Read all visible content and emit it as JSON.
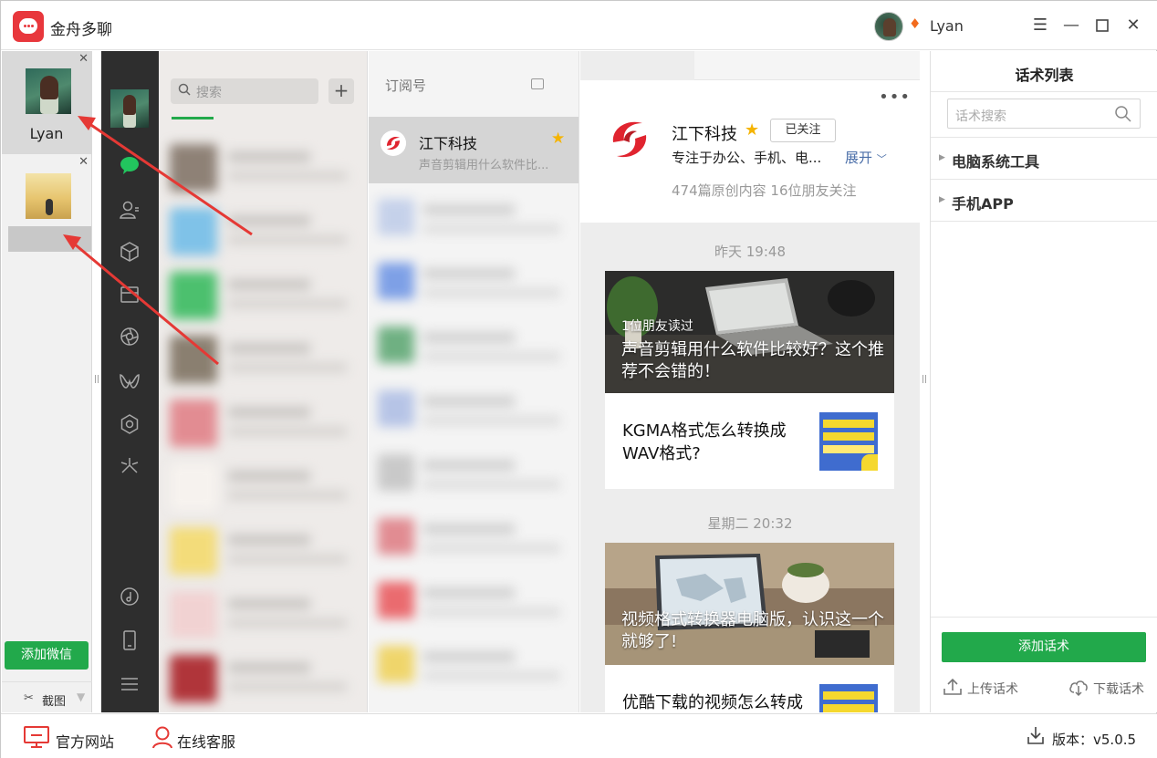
{
  "app": {
    "title": "金舟多聊",
    "user_name": "Lyan"
  },
  "accounts": {
    "items": [
      {
        "name": "Lyan"
      },
      {
        "name": ""
      }
    ],
    "add_label": "添加微信",
    "screenshot_label": "截图"
  },
  "chat_list": {
    "search_placeholder": "搜索",
    "add_label": "+"
  },
  "subscriptions": {
    "title": "订阅号",
    "items": [
      {
        "name": "江下科技",
        "desc": "声音剪辑用什么软件比...",
        "starred": true
      }
    ]
  },
  "article": {
    "account_name": "江下科技",
    "follow_label": "已关注",
    "desc": "专注于办公、手机、电...",
    "expand_label": "展开",
    "stats": "474篇原创内容  16位朋友关注",
    "groups": [
      {
        "time": "昨天  19:48",
        "cover_badge": "1位朋友读过",
        "cover_title": "声音剪辑用什么软件比较好？这个推荐不会错的！",
        "sub_title": "KGMA格式怎么转换成WAV格式?"
      },
      {
        "time": "星期二  20:32",
        "cover_title": "视频格式转换器电脑版，认识这一个就够了!",
        "sub_title": "优酷下载的视频怎么转成"
      }
    ]
  },
  "scripts_panel": {
    "title": "话术列表",
    "search_placeholder": "话术搜索",
    "groups": [
      "电脑系统工具",
      "手机APP"
    ],
    "add_label": "添加话术",
    "upload_label": "上传话术",
    "download_label": "下载话术"
  },
  "footer": {
    "website_label": "官方网站",
    "service_label": "在线客服",
    "version_label": "版本：v5.0.5"
  },
  "colors": {
    "accent_green": "#22a94b",
    "brand_red": "#e8373c",
    "annotation_red": "#e53935"
  }
}
